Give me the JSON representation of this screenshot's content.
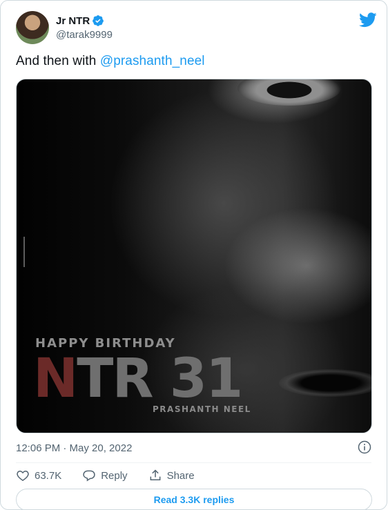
{
  "author": {
    "display_name": "Jr NTR",
    "handle": "@tarak9999",
    "verified": true,
    "avatar_icon": "profile-photo"
  },
  "brand": {
    "logo_icon": "twitter-bird-icon",
    "accent": "#1d9bf0"
  },
  "tweet": {
    "text_prefix": "And then with ",
    "mention": "@prashanth_neel",
    "timestamp": "12:06 PM · May 20, 2022"
  },
  "media": {
    "poster_subtitle": "HAPPY BIRTHDAY",
    "poster_title_red": "N",
    "poster_title_rest": "TR 31",
    "poster_credit": "PRASHANTH NEEL"
  },
  "actions": {
    "like_count": "63.7K",
    "reply_label": "Reply",
    "share_label": "Share"
  },
  "read_replies_label": "Read 3.3K replies",
  "colors": {
    "text": "#0f1419",
    "secondary": "#536471",
    "border": "#cfd9de"
  }
}
